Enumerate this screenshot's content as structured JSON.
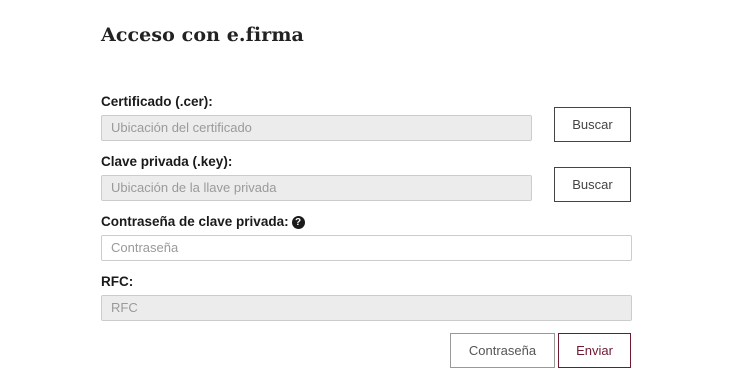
{
  "page": {
    "title": "Acceso con e.firma"
  },
  "certificado": {
    "label": "Certificado (.cer):",
    "placeholder": "Ubicación del certificado",
    "button": "Buscar"
  },
  "clave": {
    "label": "Clave privada (.key):",
    "placeholder": "Ubicación de la llave privada",
    "button": "Buscar"
  },
  "contrasena": {
    "label": "Contraseña de clave privada:",
    "placeholder": "Contraseña",
    "help_icon": "?"
  },
  "rfc": {
    "label": "RFC:",
    "placeholder": "RFC"
  },
  "actions": {
    "contrasena_button": "Contraseña",
    "enviar_button": "Enviar"
  },
  "colors": {
    "accent": "#6f1a32",
    "disabled_bg": "#ececec"
  }
}
